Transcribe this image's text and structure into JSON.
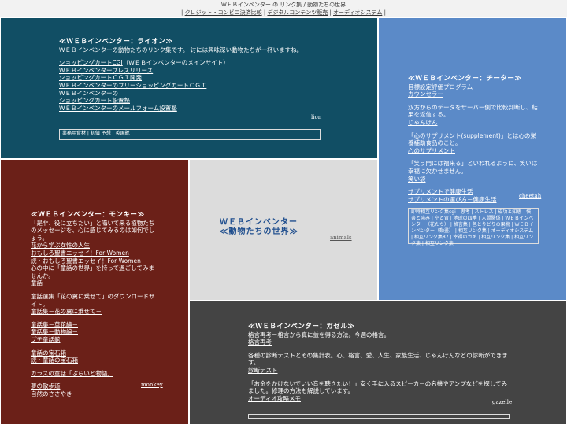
{
  "header": {
    "title": "ＷＥＢインベンター の リンク集 / 動物たちの世界",
    "nav": [
      "クレジット・コンビニ決済比較",
      "デジタルコンテンツ販売",
      "オーディオシステム"
    ]
  },
  "lion": {
    "title": "≪ＷＥＢインベンター：ライオン≫",
    "intro": "ＷＥＢインベンターの動物たちのリンク集です。 讨には興味深い動物たちが一杯いますね。",
    "links": [
      {
        "text": "ショッピングカートCGI",
        "suffix": "（ＷＥＢインベンターのメインサイト）"
      },
      {
        "text": "ＷＥＢインベンタープレスリリース",
        "suffix": ""
      },
      {
        "text": "ショッピングカートＣＧＩ開発",
        "suffix": ""
      },
      {
        "text": "ＷＥＢインベンターのフリーショッピングカートＣＧＩ",
        "suffix": ""
      }
    ],
    "text1": "ＷＥＢインベンターの",
    "link5": "ショッピングカート設置塾",
    "link6": "ＷＥＢインベンターのメールフォーム設置塾",
    "sign": "lion",
    "tags": "業務用食材 | 初値 予想 | 英国靴"
  },
  "cheetah": {
    "title": "≪ＷＥＢインベンター：チーター≫",
    "p1": "目標設定評価プログラム",
    "link1": "カウンセラー",
    "p2": "双方からのデータをサーバー側で比較判断し、結果を返信する。",
    "link2": "じゃんけん",
    "p3": "「心のサプリメント(supplement)」とは心の栄養補助食品のこと。",
    "link3": "心のサプリメント",
    "p4": "「笑う門には福来る」といわれるように、笑いは幸福に欠かせません。",
    "link4": "笑い袋",
    "link5": "サプリメントで健康生活",
    "link6": "サプリメントの選び方－健康生活",
    "sign": "cheetah",
    "tags": "即時相互リンク集cgi | 思考 | ストレス | 成功と知恵 | 慣書と強み | 空と冒 | 地球の四季 | 人間関係 | ＷＥＢインベンター（花たち） | 格言集 | 色とりどりの果物 | ＷＥＢインベンター（動畫） | 相互リンク集 | オーディオシステム | 相互リンク集87 | 幸福のカギ | 相互リンク集 | 相互リンク集 | 相互リンク集"
  },
  "monkey": {
    "title": "≪ＷＥＢインベンター：モンキー≫",
    "p1": "「是非、役に立ちたい」と囁いて来る植物たちのメッセージを、心に感じてみるのは如何でしょう。",
    "link1": "花から学ぶ女性の人生",
    "link2": "おもしろ聖書エッセイ！For Women",
    "link3": "続・おもしろ聖書エッセイ！For Women",
    "p2": "心の中に「童話の世界」を持って過ごしてみませんか。",
    "link4": "童話",
    "p3": "童話選集「花の翼に乗せて」のダウンロードサイト。",
    "link5": "童話集－花の翼に乗せて－",
    "link6": "童話集－草花編－",
    "link7": "童話集－動物編－",
    "link8": "プチ童話館",
    "link9": "童話の宝石箱",
    "link10": "続・童話の宝石箱",
    "link11": "カラスの童話「ぶらいど物語」",
    "link12": "夢の散歩道",
    "link13": "自然のささやき",
    "sign": "monkey"
  },
  "center": {
    "line1": "ＷＥＢインベンター",
    "line2": "≪動物たちの世界≫",
    "sign": "animals"
  },
  "gazelle": {
    "title": "≪ＷＥＢインベンター：ガゼル≫",
    "p1": "格言再考－格言から真に益を得る方法。今週の格言。",
    "link1": "格言再考",
    "p2": "各種の診断テストとその集計表。心、格言、愛、人生、家族生活、じゃんけんなどの診断ができます。",
    "link2": "診断テスト",
    "p3": "「お金をかけないでいい音を聴きたい！」安く手に入るスピーカーの名機やアンプなどを探してみました。修理の方法も解説しています。",
    "link3": "オーディオ攻略メモ",
    "sign": "gazelle"
  }
}
